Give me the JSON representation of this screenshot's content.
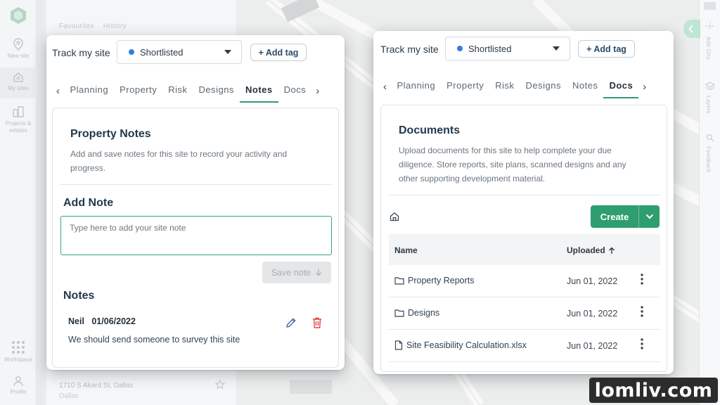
{
  "rail": {
    "items": [
      {
        "label": "New site"
      },
      {
        "label": "My sites"
      },
      {
        "label": "Projects & estates"
      },
      {
        "label": "Workspace"
      },
      {
        "label": "Profile"
      }
    ]
  },
  "background_panel": {
    "tabs": [
      "Favourites",
      "History"
    ],
    "address": "1710 S Akard St, Dallas",
    "city": "Dallas"
  },
  "left_card": {
    "track_label": "Track my site",
    "status": "Shortlisted",
    "add_tag": "+ Add tag",
    "tabs": [
      "Planning",
      "Property",
      "Risk",
      "Designs",
      "Notes",
      "Docs"
    ],
    "active_tab": "Notes",
    "title": "Property Notes",
    "description": "Add and save notes for this site to record your activity and progress.",
    "add_note_heading": "Add Note",
    "note_placeholder": "Type here to add your site note",
    "save_note": "Save note",
    "notes_heading": "Notes",
    "notes": [
      {
        "author": "Neil",
        "date": "01/06/2022",
        "text": "We should send someone to survey this site"
      }
    ]
  },
  "right_card": {
    "track_label": "Track my site",
    "status": "Shortlisted",
    "add_tag": "+ Add tag",
    "tabs": [
      "Planning",
      "Property",
      "Risk",
      "Designs",
      "Notes",
      "Docs"
    ],
    "active_tab": "Docs",
    "title": "Documents",
    "description": "Upload documents for this site to help complete your due diligence. Store reports, site plans, scanned designs and any other supporting development material.",
    "create": "Create",
    "columns": {
      "name": "Name",
      "uploaded": "Uploaded"
    },
    "files": [
      {
        "name": "Property Reports",
        "type": "folder",
        "uploaded": "Jun 01, 2022"
      },
      {
        "name": "Designs",
        "type": "folder",
        "uploaded": "Jun 01, 2022"
      },
      {
        "name": "Site Feasibility Calculation.xlsx",
        "type": "file",
        "uploaded": "Jun 01, 2022"
      }
    ]
  },
  "right_strip": {
    "labels": [
      "Add Ons",
      "Layers",
      "Feedback"
    ]
  },
  "watermark": "lomliv.com",
  "colors": {
    "accent_green": "#2e9e6e",
    "status_blue": "#2f7fe0",
    "delete_red": "#e0474c",
    "edit_blue": "#3d6fa5"
  }
}
